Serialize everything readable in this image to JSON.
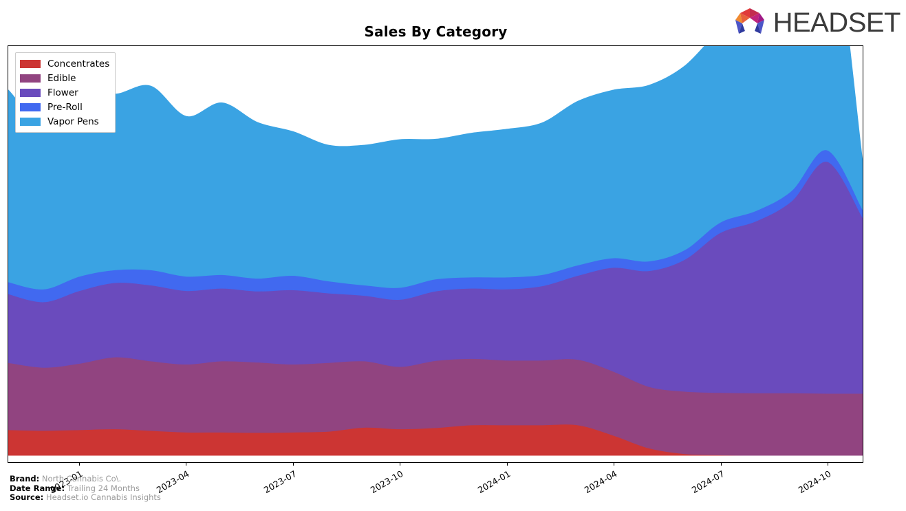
{
  "header": {
    "title": "Sales By Category",
    "logo_text": "HEADSET",
    "logo_icon": "headset-hexagon-logo"
  },
  "footnotes": [
    {
      "key": "Brand:",
      "value": "North Cannabis Co\\."
    },
    {
      "key": "Date Range:",
      "value": "Trailing 24 Months"
    },
    {
      "key": "Source:",
      "value": "Headset.io Cannabis Insights"
    }
  ],
  "legend": {
    "position": "upper-left",
    "items": [
      {
        "label": "Concentrates",
        "color": "#cc3533"
      },
      {
        "label": "Edible",
        "color": "#914480"
      },
      {
        "label": "Flower",
        "color": "#6a4bbd"
      },
      {
        "label": "Pre-Roll",
        "color": "#4169f0"
      },
      {
        "label": "Vapor Pens",
        "color": "#3aa3e3"
      }
    ]
  },
  "chart_data": {
    "type": "area",
    "stacked": true,
    "title": "Sales By Category",
    "xlabel": "",
    "ylabel": "",
    "grid": false,
    "legend_position": "upper-left",
    "x": [
      "2022-11",
      "2022-12",
      "2023-01",
      "2023-02",
      "2023-03",
      "2023-04",
      "2023-05",
      "2023-06",
      "2023-07",
      "2023-08",
      "2023-09",
      "2023-10",
      "2023-11",
      "2023-12",
      "2024-01",
      "2024-02",
      "2024-03",
      "2024-04",
      "2024-05",
      "2024-06",
      "2024-07",
      "2024-08",
      "2024-09",
      "2024-10",
      "2024-11"
    ],
    "xtick_labels": [
      "2023-01",
      "2023-04",
      "2023-07",
      "2023-10",
      "2024-01",
      "2024-04",
      "2024-07",
      "2024-10"
    ],
    "xtick_positions": [
      2,
      5,
      8,
      11,
      14,
      17,
      20,
      23
    ],
    "ylim": [
      0,
      100
    ],
    "series": [
      {
        "name": "Concentrates",
        "color": "#cc3533",
        "values": [
          6.4,
          6.2,
          6.4,
          6.6,
          6.2,
          5.8,
          5.8,
          5.7,
          5.8,
          6.0,
          7.0,
          6.6,
          6.9,
          7.6,
          7.6,
          7.6,
          7.6,
          5.0,
          1.8,
          0.4,
          0.1,
          0.0,
          0.0,
          0.0,
          0.0
        ]
      },
      {
        "name": "Edible",
        "color": "#914480",
        "values": [
          16.8,
          15.8,
          16.6,
          18.0,
          17.4,
          17.0,
          17.8,
          17.6,
          17.0,
          17.2,
          16.6,
          15.6,
          16.8,
          16.6,
          16.2,
          16.2,
          16.4,
          16.0,
          15.4,
          15.6,
          15.6,
          15.6,
          15.6,
          15.5,
          15.5
        ]
      },
      {
        "name": "Flower",
        "color": "#6a4bbd",
        "values": [
          17.2,
          16.4,
          18.2,
          18.6,
          19.0,
          18.4,
          18.2,
          17.8,
          18.6,
          17.4,
          16.4,
          16.8,
          17.4,
          17.6,
          17.8,
          18.6,
          21.0,
          26.0,
          29.0,
          33.0,
          40.0,
          43.0,
          48.0,
          58.0,
          44.0
        ]
      },
      {
        "name": "Pre-Roll",
        "color": "#4169f0",
        "values": [
          3.0,
          3.2,
          3.6,
          3.2,
          3.8,
          3.6,
          3.4,
          3.2,
          3.6,
          3.0,
          2.6,
          3.0,
          3.0,
          2.8,
          3.0,
          2.8,
          2.6,
          2.4,
          2.4,
          2.4,
          2.6,
          2.6,
          2.6,
          2.9,
          2.0
        ]
      },
      {
        "name": "Vapor Pens",
        "color": "#3aa3e3",
        "values": [
          48.0,
          41.6,
          47.2,
          44.0,
          46.0,
          40.0,
          43.0,
          39.0,
          36.0,
          34.0,
          35.0,
          37.0,
          35.0,
          36.0,
          37.0,
          38.0,
          41.0,
          42.0,
          44.0,
          46.0,
          48.0,
          50.0,
          56.0,
          64.0,
          12.0
        ]
      }
    ]
  }
}
